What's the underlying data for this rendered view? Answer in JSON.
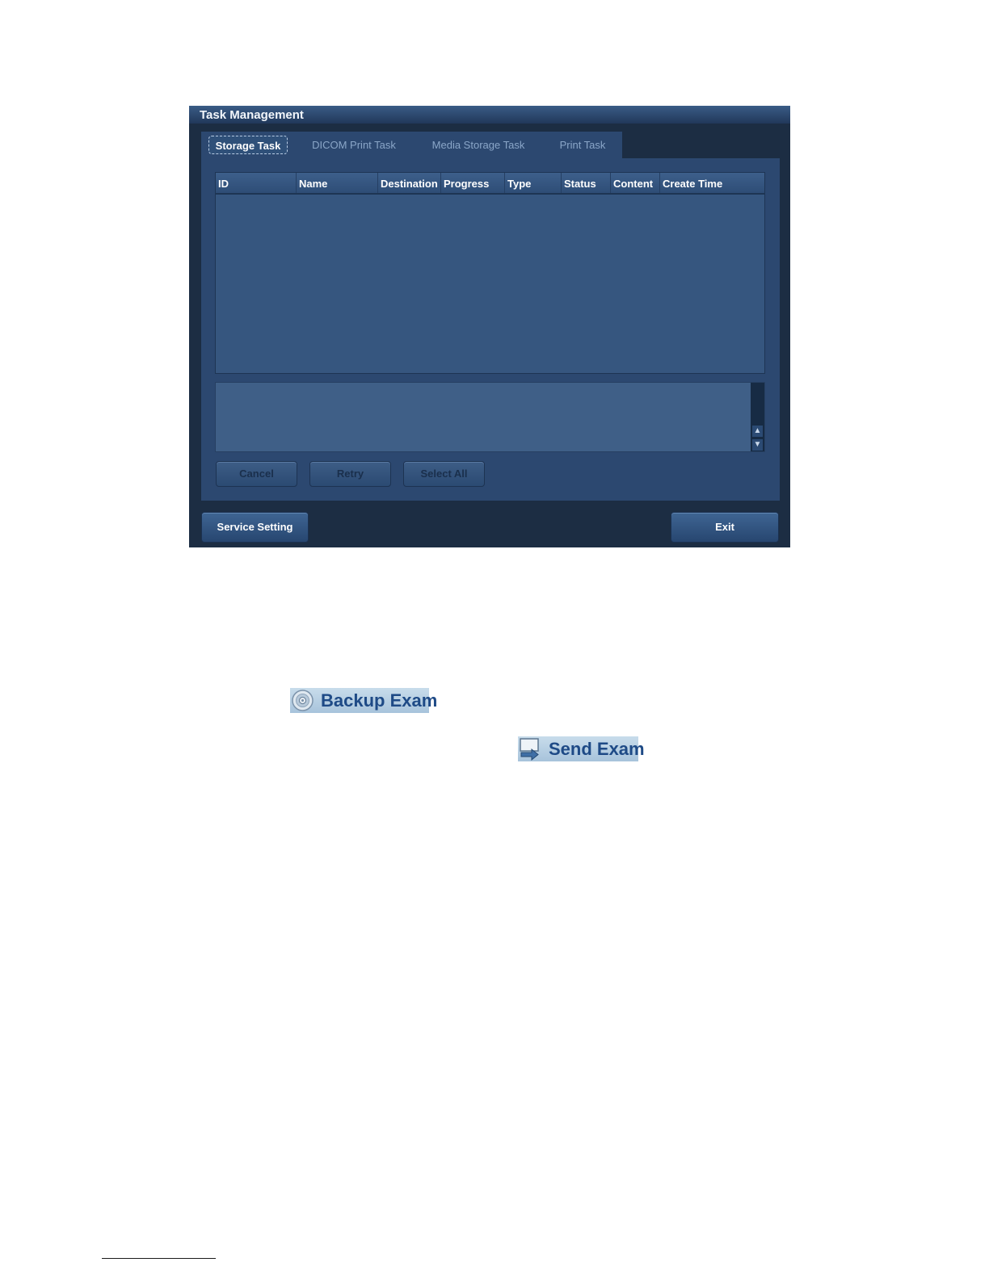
{
  "window": {
    "title": "Task Management"
  },
  "tabs": [
    {
      "label": "Storage Task",
      "active": true
    },
    {
      "label": "DICOM Print Task",
      "active": false
    },
    {
      "label": "Media Storage Task",
      "active": false
    },
    {
      "label": "Print Task",
      "active": false
    }
  ],
  "table": {
    "columns": [
      "ID",
      "Name",
      "Destination",
      "Progress",
      "Type",
      "Status",
      "Content",
      "Create Time"
    ],
    "rows": []
  },
  "panel_buttons": {
    "cancel": "Cancel",
    "retry": "Retry",
    "select_all": "Select All"
  },
  "footer": {
    "service_setting": "Service Setting",
    "exit": "Exit"
  },
  "inline_buttons": {
    "backup_exam": {
      "label": "Backup Exam",
      "icon": "disc-icon"
    },
    "send_exam": {
      "label": "Send Exam",
      "icon": "send-arrow-icon"
    }
  },
  "colors": {
    "window_bg": "#1c2d43",
    "panel_bg": "#2c4870",
    "table_bg": "#36567f",
    "inline_button_text": "#1e4a86"
  }
}
